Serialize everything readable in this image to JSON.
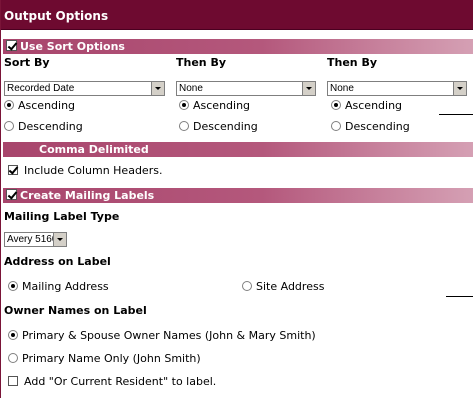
{
  "title": "Output Options",
  "sort_section": {
    "label": "Use Sort Options",
    "checked": true,
    "columns": [
      {
        "header": "Sort By",
        "selected": "Recorded Date",
        "asc_label": "Ascending",
        "desc_label": "Descending",
        "order": "ascending"
      },
      {
        "header": "Then By",
        "selected": "None",
        "asc_label": "Ascending",
        "desc_label": "Descending",
        "order": "ascending"
      },
      {
        "header": "Then By",
        "selected": "None",
        "asc_label": "Ascending",
        "desc_label": "Descending",
        "order": "ascending"
      }
    ]
  },
  "comma_section": {
    "label": "Comma Delimited",
    "include_headers_label": "Include Column Headers.",
    "include_headers_checked": true
  },
  "mailing_section": {
    "label": "Create Mailing Labels",
    "checked": true,
    "label_type_heading": "Mailing Label Type",
    "label_type_selected": "Avery 5160",
    "address_heading": "Address on Label",
    "address_options": [
      "Mailing Address",
      "Site Address"
    ],
    "address_selected": "Mailing Address",
    "owner_heading": "Owner Names on Label",
    "owner_options": [
      "Primary & Spouse Owner Names (John & Mary Smith)",
      "Primary Name Only (John Smith)"
    ],
    "owner_selected": "Primary & Spouse Owner Names (John & Mary Smith)",
    "current_resident_label": "Add \"Or Current Resident\" to label.",
    "current_resident_checked": false
  },
  "colors": {
    "title_bg": "#6e0a30",
    "section_bg": "#a8456c"
  }
}
